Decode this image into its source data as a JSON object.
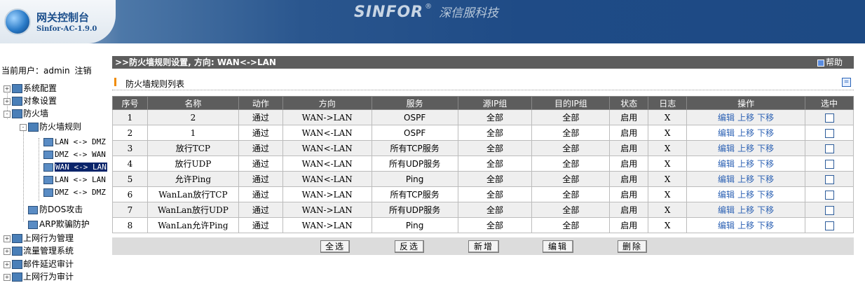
{
  "header": {
    "app_title": "网关控制台",
    "version": "Sinfor-AC-1.9.0",
    "brand_name": "SINFOR",
    "brand_reg": "®",
    "brand_cn": "深信服科技"
  },
  "sidebar": {
    "current_user_label": "当前用户：admin",
    "logout_label": "注销",
    "items": [
      {
        "label": "系统配置",
        "toggle": "+"
      },
      {
        "label": "对象设置",
        "toggle": "+"
      },
      {
        "label": "防火墙",
        "toggle": "-"
      },
      {
        "label": "防火墙规则",
        "toggle": "-"
      },
      {
        "label": "LAN <-> DMZ"
      },
      {
        "label": "DMZ <-> WAN"
      },
      {
        "label": "WAN <-> LAN",
        "selected": true
      },
      {
        "label": "LAN <-> LAN"
      },
      {
        "label": "DMZ <-> DMZ"
      },
      {
        "label": "防DOS攻击"
      },
      {
        "label": "ARP欺骗防护"
      },
      {
        "label": "上网行为管理",
        "toggle": "+"
      },
      {
        "label": "流量管理系统",
        "toggle": "+"
      },
      {
        "label": "邮件延迟审计",
        "toggle": "+"
      },
      {
        "label": "上网行为审计",
        "toggle": "+"
      }
    ]
  },
  "main": {
    "title": ">>防火墙规则设置, 方向: WAN<->LAN",
    "help_label": "帮助",
    "section_title": "防火墙规则列表",
    "columns": [
      "序号",
      "名称",
      "动作",
      "方向",
      "服务",
      "源IP组",
      "目的IP组",
      "状态",
      "日志",
      "操作",
      "选中"
    ],
    "operations": {
      "edit": "编辑",
      "up": "上移",
      "down": "下移"
    },
    "rows": [
      {
        "no": "1",
        "name": "2",
        "action": "通过",
        "direction": "WAN->LAN",
        "service": "OSPF",
        "src": "全部",
        "dst": "全部",
        "status": "启用",
        "log": "X"
      },
      {
        "no": "2",
        "name": "1",
        "action": "通过",
        "direction": "WAN<-LAN",
        "service": "OSPF",
        "src": "全部",
        "dst": "全部",
        "status": "启用",
        "log": "X"
      },
      {
        "no": "3",
        "name": "放行TCP",
        "action": "通过",
        "direction": "WAN<-LAN",
        "service": "所有TCP服务",
        "src": "全部",
        "dst": "全部",
        "status": "启用",
        "log": "X"
      },
      {
        "no": "4",
        "name": "放行UDP",
        "action": "通过",
        "direction": "WAN<-LAN",
        "service": "所有UDP服务",
        "src": "全部",
        "dst": "全部",
        "status": "启用",
        "log": "X"
      },
      {
        "no": "5",
        "name": "允许Ping",
        "action": "通过",
        "direction": "WAN<-LAN",
        "service": "Ping",
        "src": "全部",
        "dst": "全部",
        "status": "启用",
        "log": "X"
      },
      {
        "no": "6",
        "name": "WanLan放行TCP",
        "action": "通过",
        "direction": "WAN->LAN",
        "service": "所有TCP服务",
        "src": "全部",
        "dst": "全部",
        "status": "启用",
        "log": "X"
      },
      {
        "no": "7",
        "name": "WanLan放行UDP",
        "action": "通过",
        "direction": "WAN->LAN",
        "service": "所有UDP服务",
        "src": "全部",
        "dst": "全部",
        "status": "启用",
        "log": "X"
      },
      {
        "no": "8",
        "name": "WanLan允许Ping",
        "action": "通过",
        "direction": "WAN->LAN",
        "service": "Ping",
        "src": "全部",
        "dst": "全部",
        "status": "启用",
        "log": "X"
      }
    ],
    "buttons": {
      "select_all": "全选",
      "invert": "反选",
      "add": "新增",
      "edit": "编辑",
      "delete": "删除"
    }
  },
  "colors": {
    "header_bg": "#1f4b86",
    "bar_gray": "#5d5d5d",
    "link_blue": "#2d62b4",
    "accent_orange": "#f08c00",
    "selection": "#0a246a"
  }
}
